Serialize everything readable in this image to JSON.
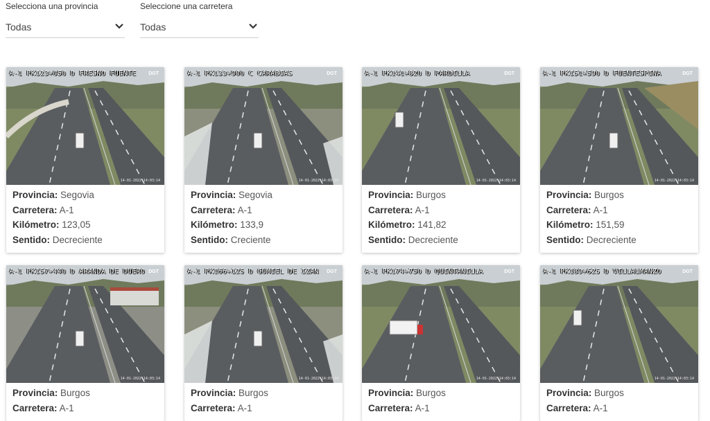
{
  "filters": {
    "province": {
      "label": "Selecciona una provincia",
      "value": "Todas"
    },
    "road": {
      "label": "Seleccione una carretera",
      "value": "Todas"
    }
  },
  "field_labels": {
    "province": "Provincia:",
    "road": "Carretera:",
    "km": "Kilómetro:",
    "direction": "Sentido:"
  },
  "cameras": [
    {
      "caption": "A-1 PK123+050 D FRESNO FUENTE",
      "province": "Segovia",
      "road": "A-1",
      "km": "123,05",
      "direction": "Decreciente",
      "scene": "curve"
    },
    {
      "caption": "A-1 PK133+900 C CARABIAS",
      "province": "Segovia",
      "road": "A-1",
      "km": "133,9",
      "direction": "Creciente",
      "scene": "snow"
    },
    {
      "caption": "A-1 PK141+820 D PARDILLA",
      "province": "Burgos",
      "road": "A-1",
      "km": "141,82",
      "direction": "Decreciente",
      "scene": "straight"
    },
    {
      "caption": "A-1 PK151+590 D FUENTESPINA",
      "province": "Burgos",
      "road": "A-1",
      "km": "151,59",
      "direction": "Decreciente",
      "scene": "fields"
    },
    {
      "caption": "A-1 PK157+440 D ARANDA DE DUERO",
      "province": "Burgos",
      "road": "A-1",
      "scene": "industrial"
    },
    {
      "caption": "A-1 PK166+125 D GUMIEL DE IZAN",
      "province": "Burgos",
      "road": "A-1",
      "scene": "snow"
    },
    {
      "caption": "A-1 PK174+750 D QUINTANILLA",
      "province": "Burgos",
      "road": "A-1",
      "scene": "truck"
    },
    {
      "caption": "A-1 PK189+625 D VILLALMANZO",
      "province": "Burgos",
      "road": "A-1",
      "scene": "straight"
    }
  ],
  "camera_logo": "DGT",
  "camera_stamp": "14-01-2022 14:03:14"
}
